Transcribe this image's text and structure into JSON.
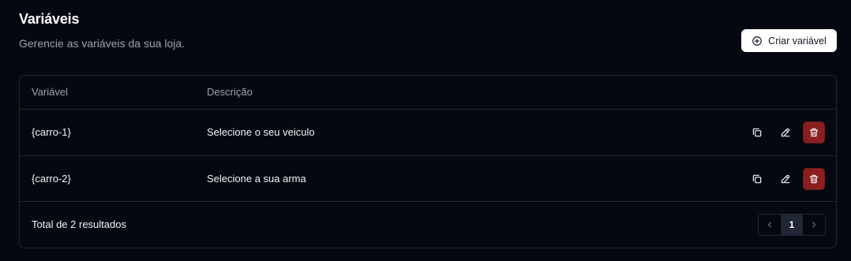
{
  "header": {
    "title": "Variáveis",
    "subtitle": "Gerencie as variáveis da sua loja.",
    "create_button_label": "Criar variável"
  },
  "table": {
    "columns": {
      "variable": "Variável",
      "description": "Descrição"
    },
    "rows": [
      {
        "variable": "{carro-1}",
        "description": "Selecione o seu veiculo"
      },
      {
        "variable": "{carro-2}",
        "description": "Selecione a sua arma"
      }
    ],
    "footer": {
      "total_text": "Total de 2 resultados",
      "current_page": "1"
    }
  },
  "icons": {
    "create": "plus-circle-icon",
    "copy": "copy-icon",
    "edit": "edit-icon",
    "delete": "trash-icon",
    "previous": "chevron-left-icon",
    "next": "chevron-right-icon"
  },
  "colors": {
    "background": "#050810",
    "border": "#1f2633",
    "muted_text": "#9ca3af",
    "danger": "#8b1f1f",
    "pagination_active": "#202633"
  }
}
